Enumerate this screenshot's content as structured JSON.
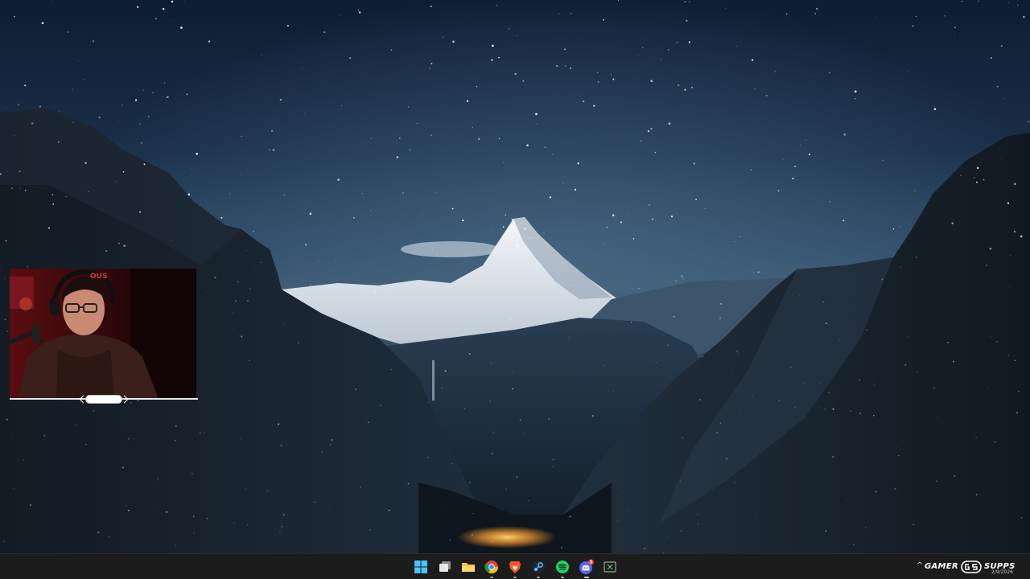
{
  "desktop": {
    "wallpaper": "starry-mountain-night"
  },
  "webcam": {
    "badge_text": "OUS"
  },
  "taskbar": {
    "pinned": [
      {
        "name": "start-button",
        "icon": "windows-logo-icon",
        "color": "#4cc2ff",
        "running": false
      },
      {
        "name": "task-view-button",
        "icon": "task-view-icon",
        "color": "#d0d0d0",
        "running": false
      },
      {
        "name": "file-explorer-button",
        "icon": "folder-icon",
        "color": "#f5c342",
        "running": false
      },
      {
        "name": "chrome-button",
        "icon": "chrome-icon",
        "color": "#db4437",
        "running": true
      },
      {
        "name": "brave-button",
        "icon": "brave-icon",
        "color": "#fb542b",
        "running": true
      },
      {
        "name": "steam-button",
        "icon": "steam-icon",
        "color": "#66c0f4",
        "running": true
      },
      {
        "name": "spotify-button",
        "icon": "spotify-icon",
        "color": "#1ed760",
        "running": true
      },
      {
        "name": "discord-button",
        "icon": "discord-icon",
        "color": "#5865f2",
        "running": true,
        "badge": "3"
      },
      {
        "name": "xbox-button",
        "icon": "xbox-icon",
        "color": "#7fb77e",
        "running": false
      }
    ]
  },
  "tray": {
    "brand_left": "GAMER",
    "brand_right": "SUPPS",
    "date": "2/9/2026"
  }
}
